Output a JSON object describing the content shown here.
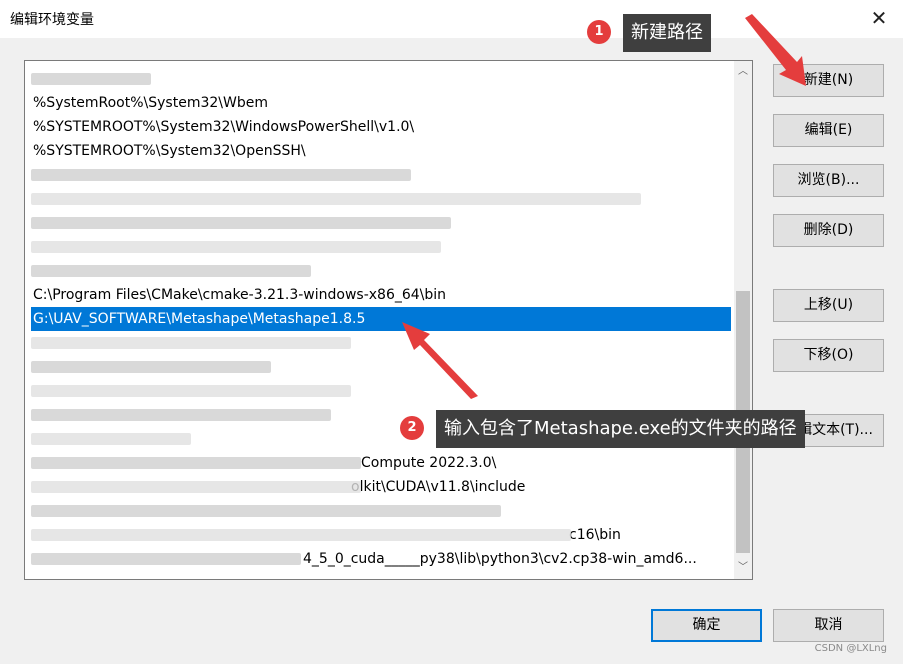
{
  "window": {
    "title": "编辑环境变量",
    "close_glyph": "✕"
  },
  "list": {
    "rows": [
      {
        "text": "",
        "blurred": true
      },
      {
        "text": "%SystemRoot%\\System32\\Wbem",
        "blurred": false
      },
      {
        "text": "%SYSTEMROOT%\\System32\\WindowsPowerShell\\v1.0\\",
        "blurred": false
      },
      {
        "text": "%SYSTEMROOT%\\System32\\OpenSSH\\",
        "blurred": false
      },
      {
        "text": "",
        "blurred": true
      },
      {
        "text": "",
        "blurred": true
      },
      {
        "text": "",
        "blurred": true
      },
      {
        "text": "",
        "blurred": true
      },
      {
        "text": "",
        "blurred": true
      },
      {
        "text": "C:\\Program Files\\CMake\\cmake-3.21.3-windows-x86_64\\bin",
        "blurred": false
      },
      {
        "text": "G:\\UAV_SOFTWARE\\Metashape\\Metashape1.8.5",
        "blurred": false,
        "selected": true
      },
      {
        "text": "",
        "blurred": true
      },
      {
        "text": "",
        "blurred": true
      },
      {
        "text": "",
        "blurred": true
      },
      {
        "text": "",
        "blurred": true
      },
      {
        "text": "",
        "blurred": true
      },
      {
        "text": "Compute 2022.3.0\\",
        "blurred": false,
        "partial": true
      },
      {
        "text": "olkit\\CUDA\\v11.8\\include",
        "blurred": false,
        "partial": true
      },
      {
        "text": "",
        "blurred": true
      },
      {
        "text": "c16\\bin",
        "blurred": false,
        "partial": true
      },
      {
        "text": "4_5_0_cuda_____py38\\lib\\python3\\cv2.cp38-win_amd6...",
        "blurred": false,
        "partial": true
      }
    ]
  },
  "buttons": {
    "new": "新建(N)",
    "edit": "编辑(E)",
    "browse": "浏览(B)...",
    "delete": "删除(D)",
    "up": "上移(U)",
    "down": "下移(O)",
    "text": "编辑文本(T)...",
    "ok": "确定",
    "cancel": "取消"
  },
  "annotations": {
    "step1": {
      "number": "1",
      "text": "新建路径"
    },
    "step2": {
      "number": "2",
      "text": "输入包含了Metashape.exe的文件夹的路径"
    }
  },
  "watermark": "CSDN @LXLng",
  "colors": {
    "selection": "#0078d7",
    "callout": "#3f3f3f",
    "badge": "#e43d3d",
    "arrow": "#e43d3d"
  }
}
